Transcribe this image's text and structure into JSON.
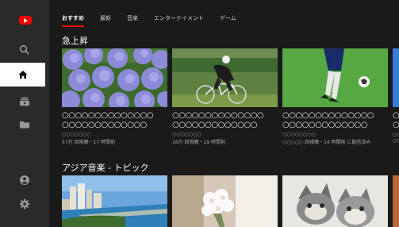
{
  "tabs": [
    {
      "label": "おすすめ",
      "active": true
    },
    {
      "label": "最新"
    },
    {
      "label": "音楽"
    },
    {
      "label": "エンターテイメント"
    },
    {
      "label": "ゲーム"
    }
  ],
  "sections": [
    {
      "title": "急上昇",
      "cards": [
        {
          "title_line1": "○○○○○○○○○○○○○○",
          "title_line2": "○○○○○○○○○○○○○",
          "channel": "○○○○○○○",
          "meta": "57万 回視聴・17 時間前"
        },
        {
          "title_line1": "○○○○○○○○○○○○○○",
          "title_line2": "○○○○○○○○○○○○○",
          "channel": "○○○○○○○",
          "meta": "16万 回視聴・19 時間前"
        },
        {
          "title_line1": "○○○○○○○○○○○○○○",
          "title_line2": "○○○○○○○○○○○○○",
          "channel": "○○○○○○○○",
          "meta": "○○○○○ 回視聴・14 時間前 に配信済み"
        },
        {
          "title_line1": "○○",
          "title_line2": "○○",
          "channel": "○○",
          "meta": "○○"
        }
      ]
    },
    {
      "title": "アジア音楽 - トピック",
      "cards": [
        {},
        {},
        {},
        {}
      ]
    }
  ],
  "icons": {
    "logo": "youtube-logo",
    "search": "search-icon",
    "home": "home-icon",
    "subscriptions": "subscriptions-icon",
    "library": "library-icon",
    "account": "account-icon",
    "settings": "gear-icon"
  }
}
